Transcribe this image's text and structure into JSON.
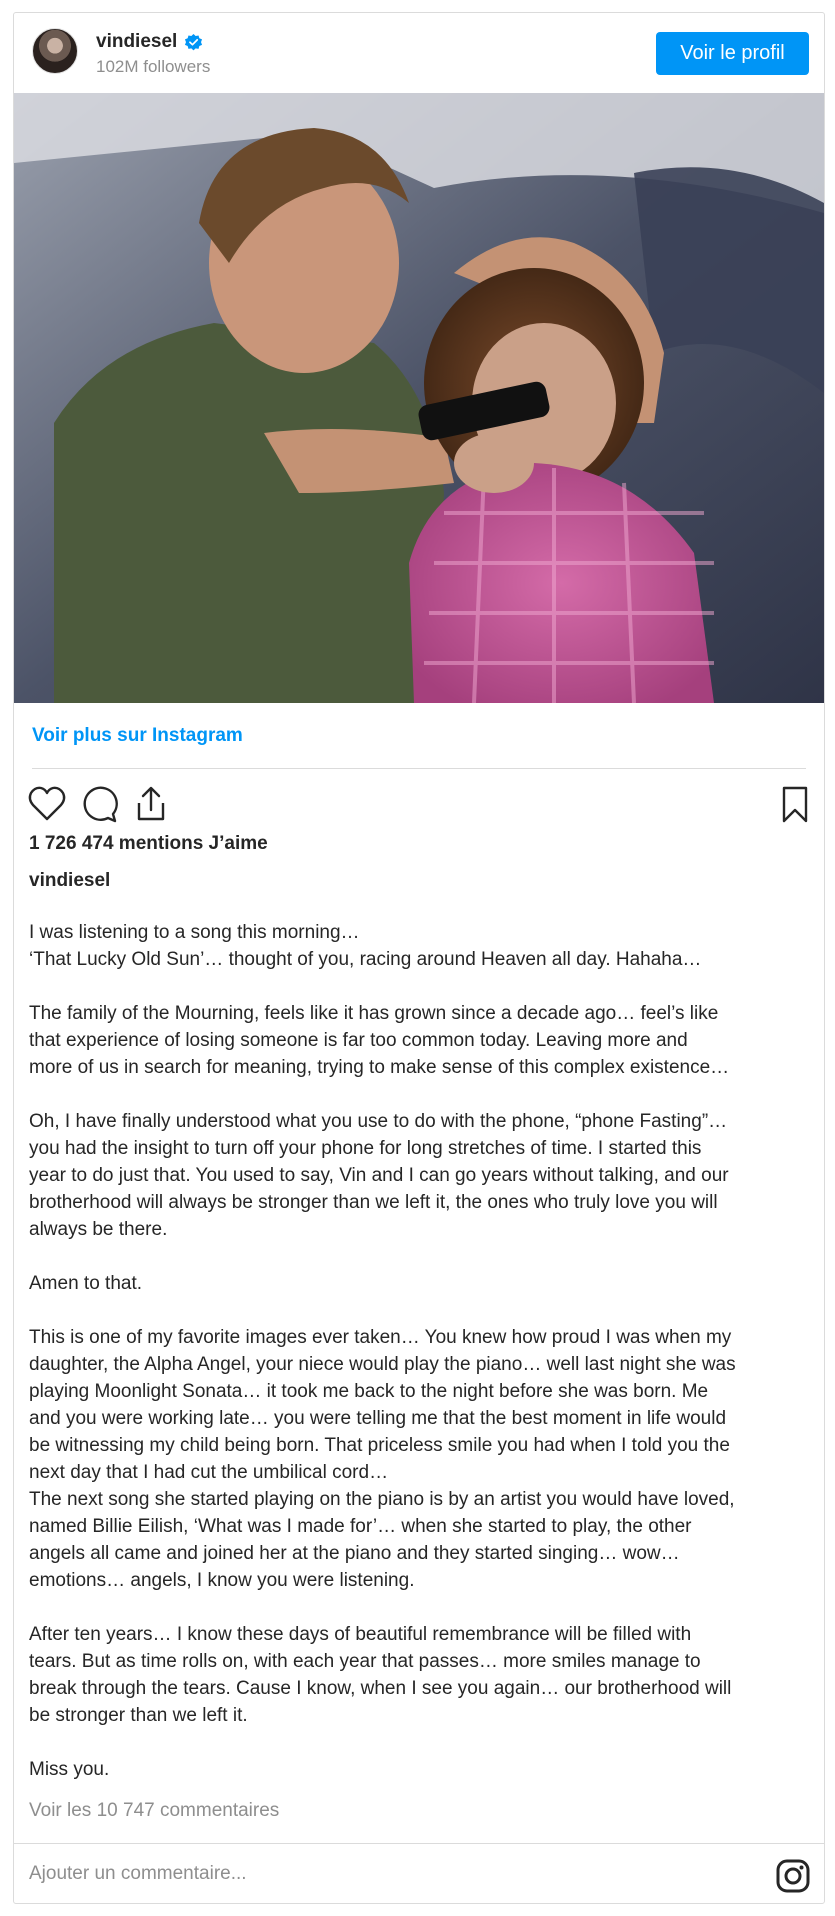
{
  "header": {
    "username": "vindiesel",
    "followers": "102M followers",
    "profile_button": "Voir le profil"
  },
  "photo": {
    "icon": "post-photo"
  },
  "more_link": "Voir plus sur Instagram",
  "actions": {
    "like_icon": "heart-icon",
    "comment_icon": "comment-icon",
    "share_icon": "share-icon",
    "save_icon": "bookmark-icon"
  },
  "likes": "1 726 474 mentions J’aime",
  "caption": {
    "username": "vindiesel",
    "lines": [
      "I was listening to a song this morning…",
      "‘That Lucky Old Sun’… thought of you, racing around Heaven all day. Hahaha…",
      "",
      "The family of the Mourning, feels like it has grown since a decade ago… feel’s like",
      "that experience of losing someone is far too common today. Leaving more and",
      "more of us in search for meaning, trying to make sense of this complex existence…",
      "",
      "Oh, I have finally understood what you use to do with the phone, “phone Fasting”…",
      "you had the insight to turn off your phone for long stretches of time. I started this",
      "year to do just that. You used to say, Vin and I can go years without talking, and our",
      "brotherhood will always be stronger than we left it, the ones who truly love you will",
      "always be there.",
      "",
      "Amen to that.",
      "",
      "This is one of my favorite images ever taken… You knew how proud I was when my",
      "daughter, the Alpha Angel, your niece would play the piano… well last night she was",
      "playing Moonlight Sonata… it took me back to the night before she was born. Me",
      "and you were working late… you were telling me that the best moment in life would",
      "be witnessing my child being born. That priceless smile you had when I told you the",
      "next day that I had cut the umbilical cord…",
      "The next song she started playing on the piano is by an artist you would have loved,",
      "named Billie Eilish, ‘What was I made for’… when she started to play, the other",
      "angels all came and joined her at the piano and they started singing… wow…",
      "emotions… angels, I know you were listening.",
      "",
      "After ten years… I know these days of beautiful remembrance will be filled with",
      "tears. But as time rolls on, with each year that passes… more smiles manage to",
      "break through the tears. Cause I know, when I see you again… our brotherhood will",
      "be stronger than we left it.",
      "",
      "Miss you."
    ]
  },
  "comments_link": "Voir les 10 747 commentaires",
  "comment_input": {
    "placeholder": "Ajouter un commentaire..."
  },
  "colors": {
    "accent": "#0095f6",
    "muted": "#8e8e8e",
    "border": "#dbdbdb"
  }
}
